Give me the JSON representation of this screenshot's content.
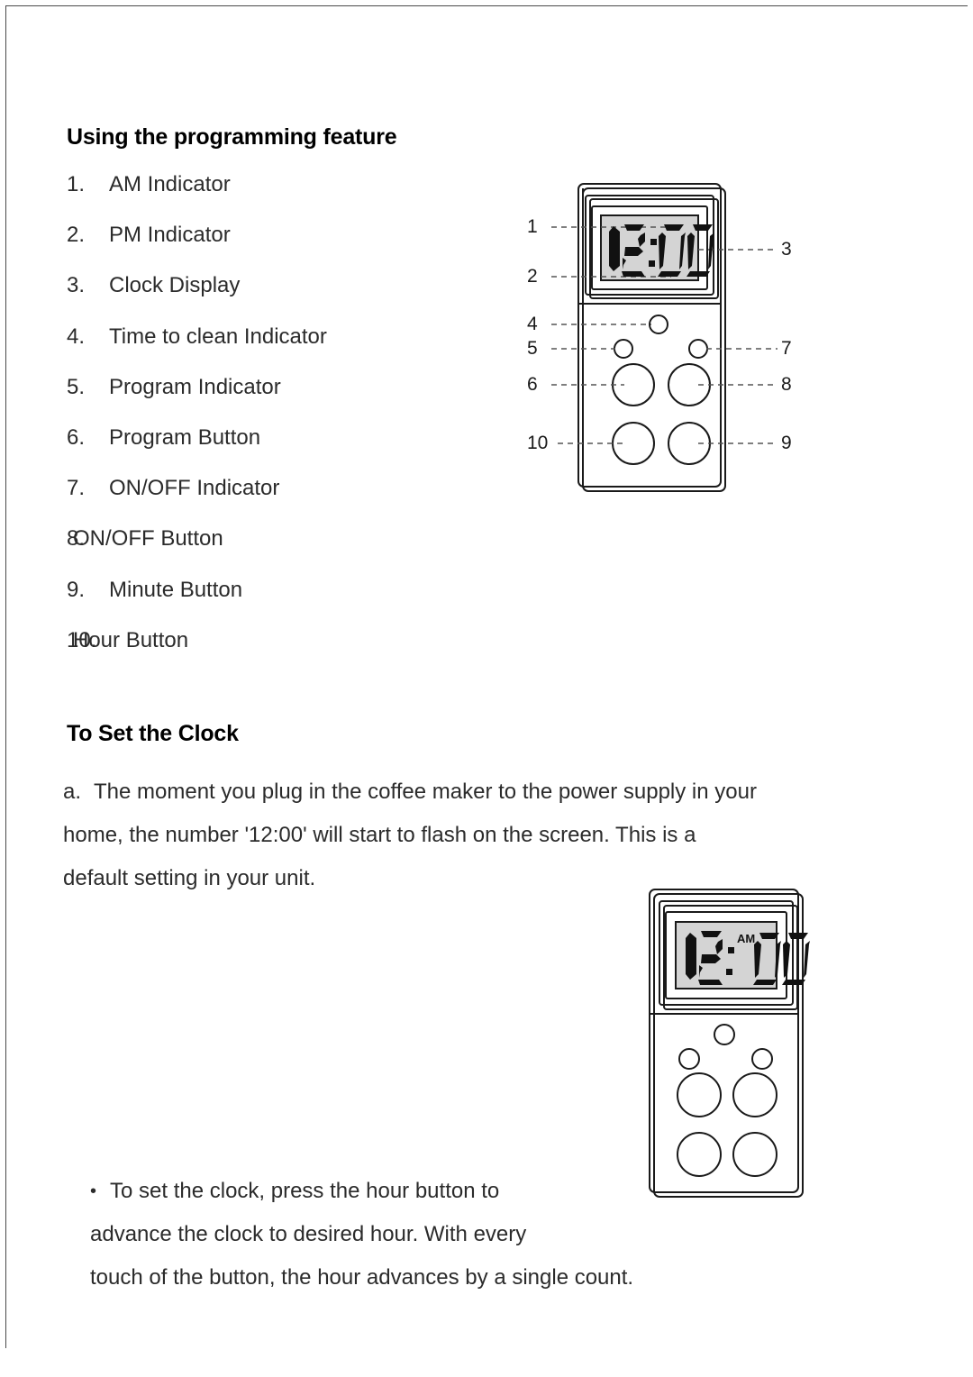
{
  "page": {
    "heading_1": "Using the programming feature",
    "heading_2": "To Set the Clock"
  },
  "parts_list": [
    {
      "num": "1.",
      "label": "AM Indicator",
      "spacing": "wide"
    },
    {
      "num": "2.",
      "label": "PM Indicator",
      "spacing": "wide"
    },
    {
      "num": "3.",
      "label": "Clock Display",
      "spacing": "wide"
    },
    {
      "num": "4.",
      "label": "Time to clean Indicator",
      "spacing": "wide"
    },
    {
      "num": "5.",
      "label": "Program Indicator",
      "spacing": "wide"
    },
    {
      "num": "6.",
      "label": "Program Button",
      "spacing": "wide"
    },
    {
      "num": "7.",
      "label": "ON/OFF Indicator",
      "spacing": "wide"
    },
    {
      "num": "8.",
      "label": "ON/OFF Button",
      "spacing": "tight"
    },
    {
      "num": "9.",
      "label": "Minute Button",
      "spacing": "wide"
    },
    {
      "num": "10.",
      "label": "Hour Button",
      "spacing": "tight"
    }
  ],
  "paragraph_a": {
    "marker": "a.",
    "line1": "The moment you plug in the coffee maker to the power supply in your",
    "line2": "home, the number '12:00'  will start to flash on the screen. This is a",
    "line3": "default setting in your unit."
  },
  "paragraph_bullet": {
    "bullet": "•",
    "line1": "To set the clock, press the hour button to",
    "line2": "advance the clock to desired hour. With every",
    "line3": "touch of the button, the hour advances by a single count."
  },
  "diagram_1": {
    "display_value": "12:00",
    "callouts_left": [
      {
        "id": "1",
        "text": "1"
      },
      {
        "id": "2",
        "text": "2"
      },
      {
        "id": "4",
        "text": "4"
      },
      {
        "id": "5",
        "text": "5"
      },
      {
        "id": "6",
        "text": "6"
      },
      {
        "id": "10",
        "text": "10"
      }
    ],
    "callouts_right": [
      {
        "id": "3",
        "text": "3"
      },
      {
        "id": "7",
        "text": "7"
      },
      {
        "id": "8",
        "text": "8"
      },
      {
        "id": "9",
        "text": "9"
      }
    ]
  },
  "diagram_2": {
    "display_value": "12:00",
    "meridiem": "AM"
  },
  "colors": {
    "ink": "#1a1a1a",
    "text": "#2b2b2b",
    "lcd_background": "#d4d4d4",
    "lcd_digits": "#111111",
    "leader_line": "#555555",
    "page_border": "#4a4a4a"
  }
}
